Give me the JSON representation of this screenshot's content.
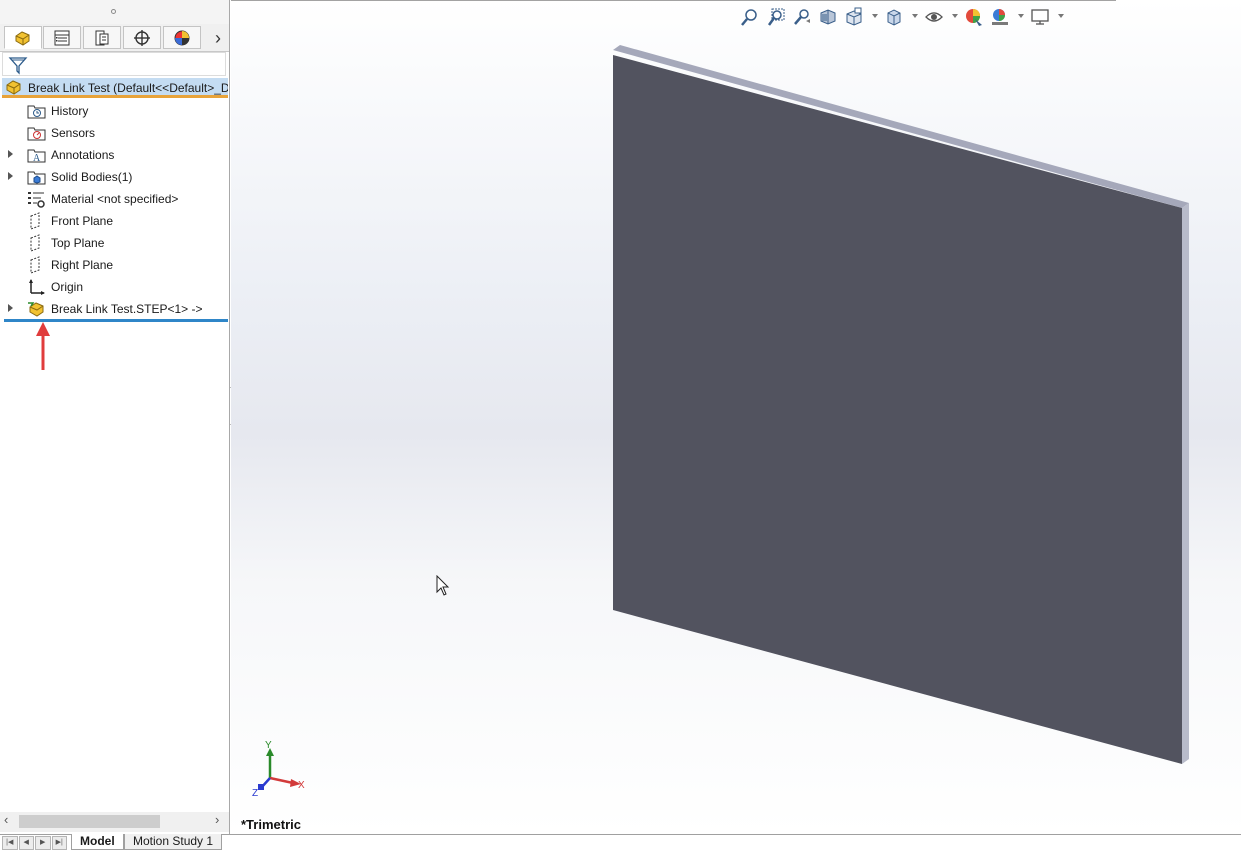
{
  "feature_tree": {
    "root_label": "Break Link Test  (Default<<Default>_D",
    "items": [
      {
        "label": "History",
        "icon": "history-folder-icon",
        "expandable": false
      },
      {
        "label": "Sensors",
        "icon": "sensors-folder-icon",
        "expandable": false
      },
      {
        "label": "Annotations",
        "icon": "annotations-folder-icon",
        "expandable": true
      },
      {
        "label": "Solid Bodies(1)",
        "icon": "solid-bodies-folder-icon",
        "expandable": true
      },
      {
        "label": "Material <not specified>",
        "icon": "material-icon",
        "expandable": false
      },
      {
        "label": "Front Plane",
        "icon": "plane-icon",
        "expandable": false
      },
      {
        "label": "Top Plane",
        "icon": "plane-icon",
        "expandable": false
      },
      {
        "label": "Right Plane",
        "icon": "plane-icon",
        "expandable": false
      },
      {
        "label": "Origin",
        "icon": "origin-icon",
        "expandable": false
      },
      {
        "label": "Break Link Test.STEP<1> ->",
        "icon": "derived-part-icon",
        "expandable": true
      }
    ]
  },
  "panel_tabs": [
    "feature-manager-tab",
    "property-manager-tab",
    "configuration-manager-tab",
    "dimxpert-manager-tab",
    "display-manager-tab"
  ],
  "viewport": {
    "view_name": "*Trimetric",
    "triad": {
      "x": "X",
      "y": "Y",
      "z": "Z"
    }
  },
  "bottom_tabs": [
    "Model",
    "Motion Study 1"
  ],
  "colors": {
    "plate_face": "#52535f",
    "plate_top": "#a5a8ba",
    "plate_side": "#b8bbca",
    "selection": "#c4dcf2",
    "rollback_bar": "#2f86c8"
  }
}
